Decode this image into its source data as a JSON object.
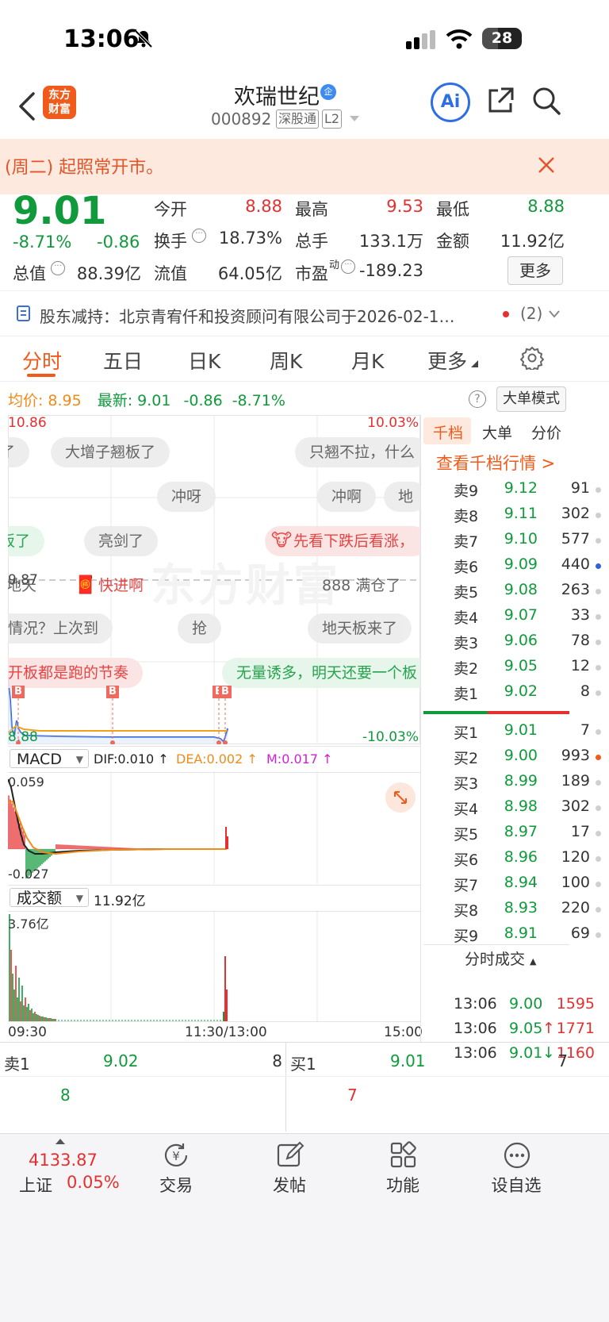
{
  "status_bar": {
    "time": "13:06",
    "battery": "28"
  },
  "header": {
    "title": "欢瑞世纪",
    "code": "000892",
    "badge_connect": "深股通",
    "badge_level": "L2",
    "logo_text_line1": "东方",
    "logo_text_line2": "财富",
    "ai_label": "Ai"
  },
  "banner": {
    "text": "(周二) 起照常开市。"
  },
  "quote": {
    "price": "9.01",
    "change_pct": "-8.71%",
    "change": "-0.86",
    "open_label": "今开",
    "open": "8.88",
    "high_label": "最高",
    "high": "9.53",
    "low_label": "最低",
    "low": "8.88",
    "turnover_label": "换手",
    "turnover": "18.73%",
    "volume_label": "总手",
    "volume": "133.1万",
    "amount_label": "金额",
    "amount": "11.92亿",
    "mktcap_label": "总值",
    "mktcap": "88.39亿",
    "float_label": "流值",
    "float_cap": "64.05亿",
    "pe_label": "市盈",
    "pe_sup": "动",
    "pe": "-189.23",
    "more_button": "更多"
  },
  "news": {
    "text": "股东减持：北京青宥仟和投资顾问有限公司于2026-02-1…",
    "count": "(2)"
  },
  "tabs": [
    "分时",
    "五日",
    "日K",
    "周K",
    "月K",
    "更多"
  ],
  "chart_info": {
    "avg_label": "均价:",
    "avg": "8.95",
    "latest_label": "最新:",
    "latest": "9.01",
    "change": "-0.86",
    "change_pct": "-8.71%",
    "mode_button": "大单模式"
  },
  "chart_labels": {
    "top_price": "10.86",
    "top_pct": "10.03%",
    "bottom_price": "8.88",
    "bottom_pct": "-10.03%",
    "mid_price": "9.87",
    "time_start": "09:30",
    "time_mid": "11:30/13:00",
    "time_end": "15:00",
    "watermark": "东方财富"
  },
  "macd": {
    "selector": "MACD",
    "dif": "DIF:0.010 ↑",
    "dea": "DEA:0.002 ↑",
    "m": "M:0.017 ↑",
    "top": "0.059",
    "bottom": "-0.027"
  },
  "volume_panel": {
    "selector": "成交额",
    "value": "11.92亿",
    "top": "3.76亿"
  },
  "bullet_comments": [
    {
      "text": "了",
      "style": "gray"
    },
    {
      "text": "大增子翘板了",
      "style": "gray"
    },
    {
      "text": "只翘不拉，什么",
      "style": "gray"
    },
    {
      "text": "冲呀",
      "style": "gray"
    },
    {
      "text": "冲啊",
      "style": "gray"
    },
    {
      "text": "地",
      "style": "gray"
    },
    {
      "text": "板了",
      "style": "green"
    },
    {
      "text": "亮剑了",
      "style": "gray"
    },
    {
      "text": "先看下跌后看涨，",
      "style": "red"
    },
    {
      "text": "地天",
      "style": "gray"
    },
    {
      "text": "快进啊",
      "style": "red"
    },
    {
      "text": "888 满仓了",
      "style": "gray"
    },
    {
      "text": "情况？上次到",
      "style": "gray"
    },
    {
      "text": "抢",
      "style": "gray"
    },
    {
      "text": "地天板来了",
      "style": "gray"
    },
    {
      "text": "开板都是跑的节奏",
      "style": "red"
    },
    {
      "text": "无量诱多，明天还要一个板",
      "style": "green"
    }
  ],
  "markers": [
    "B",
    "B",
    "B",
    "B"
  ],
  "orderbook": {
    "tabs": [
      "千档",
      "大单",
      "分价"
    ],
    "link": "查看千档行情 >",
    "asks": [
      {
        "label": "卖9",
        "price": "9.12",
        "vol": "91"
      },
      {
        "label": "卖8",
        "price": "9.11",
        "vol": "302"
      },
      {
        "label": "卖7",
        "price": "9.10",
        "vol": "577"
      },
      {
        "label": "卖6",
        "price": "9.09",
        "vol": "440"
      },
      {
        "label": "卖5",
        "price": "9.08",
        "vol": "263"
      },
      {
        "label": "卖4",
        "price": "9.07",
        "vol": "33"
      },
      {
        "label": "卖3",
        "price": "9.06",
        "vol": "78"
      },
      {
        "label": "卖2",
        "price": "9.05",
        "vol": "12"
      },
      {
        "label": "卖1",
        "price": "9.02",
        "vol": "8"
      }
    ],
    "bids": [
      {
        "label": "买1",
        "price": "9.01",
        "vol": "7"
      },
      {
        "label": "买2",
        "price": "9.00",
        "vol": "993"
      },
      {
        "label": "买3",
        "price": "8.99",
        "vol": "189"
      },
      {
        "label": "买4",
        "price": "8.98",
        "vol": "302"
      },
      {
        "label": "买5",
        "price": "8.97",
        "vol": "17"
      },
      {
        "label": "买6",
        "price": "8.96",
        "vol": "120"
      },
      {
        "label": "买7",
        "price": "8.94",
        "vol": "100"
      },
      {
        "label": "买8",
        "price": "8.93",
        "vol": "220"
      },
      {
        "label": "买9",
        "price": "8.91",
        "vol": "69"
      }
    ],
    "trades_header": "分时成交",
    "trades": [
      {
        "time": "13:06",
        "price": "9.00",
        "arrow": "",
        "vol": "1595"
      },
      {
        "time": "13:06",
        "price": "9.05",
        "arrow": "↑",
        "vol": "1771"
      },
      {
        "time": "13:06",
        "price": "9.01",
        "arrow": "↓",
        "vol": "1160"
      }
    ]
  },
  "bottom_quote": {
    "ask_label": "卖1",
    "ask_price": "9.02",
    "ask_vol": "8",
    "bid_label": "买1",
    "bid_price": "9.01",
    "bid_vol": "7",
    "ask_sub": "8",
    "bid_sub": "7"
  },
  "bottom_nav": {
    "index_value": "4133.87",
    "index_name": "上证",
    "index_change": "0.05%",
    "items": [
      "交易",
      "发帖",
      "功能",
      "设自选"
    ]
  },
  "colors": {
    "up": "#e5302f",
    "down": "#109a3c",
    "accent": "#f05a1a",
    "avg_line": "#f08b1a"
  }
}
